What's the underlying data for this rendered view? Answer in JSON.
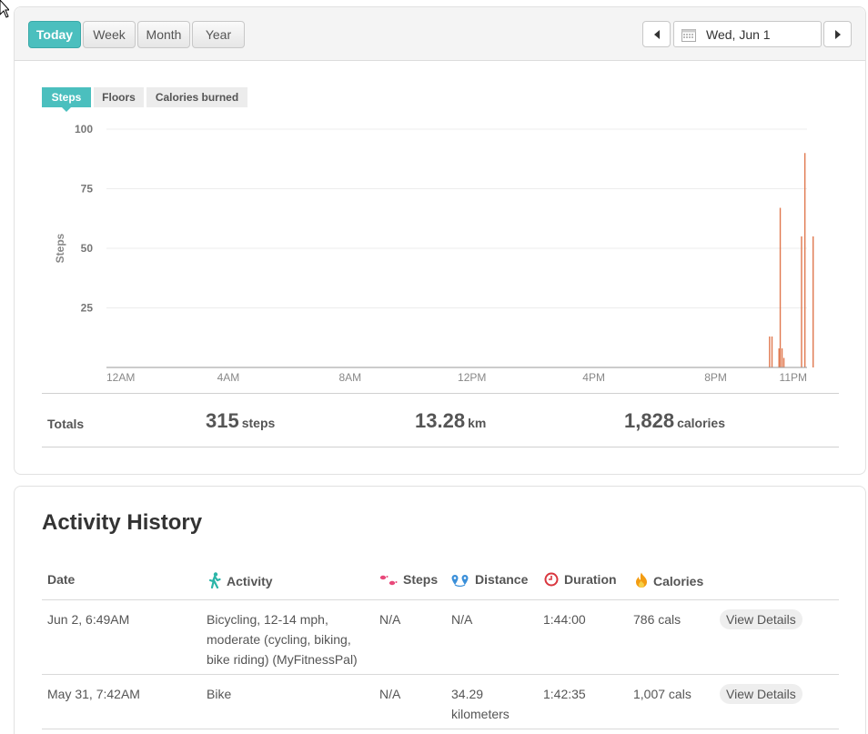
{
  "toolbar": {
    "periods": [
      "Today",
      "Week",
      "Month",
      "Year"
    ],
    "active_period": "Today",
    "date": "Wed, Jun 1"
  },
  "metric_tabs": [
    "Steps",
    "Floors",
    "Calories burned"
  ],
  "active_metric": "Steps",
  "chart_data": {
    "type": "bar",
    "ylabel": "Steps",
    "yticks": [
      100,
      75,
      50,
      25
    ],
    "ylim": [
      0,
      100
    ],
    "xticks": [
      "12AM",
      "4AM",
      "8AM",
      "12PM",
      "4PM",
      "8PM",
      "11PM"
    ],
    "x_unit": "hour of day",
    "bar_color": "#e0784e",
    "values": [
      {
        "hour": 21.77,
        "steps": 13
      },
      {
        "hour": 21.85,
        "steps": 13
      },
      {
        "hour": 22.08,
        "steps": 8
      },
      {
        "hour": 22.12,
        "steps": 67
      },
      {
        "hour": 22.18,
        "steps": 8
      },
      {
        "hour": 22.24,
        "steps": 4
      },
      {
        "hour": 22.82,
        "steps": 55
      },
      {
        "hour": 22.93,
        "steps": 90
      },
      {
        "hour": 23.2,
        "steps": 55
      }
    ]
  },
  "totals": {
    "label": "Totals",
    "steps": {
      "value": "315",
      "unit": "steps"
    },
    "distance": {
      "value": "13.28",
      "unit": "km"
    },
    "calories": {
      "value": "1,828",
      "unit": "calories"
    }
  },
  "activity_history": {
    "title": "Activity History",
    "columns": [
      {
        "label": "Date",
        "icon": ""
      },
      {
        "label": "Activity",
        "icon": "walking-person-icon"
      },
      {
        "label": "Steps",
        "icon": "footprints-icon"
      },
      {
        "label": "Distance",
        "icon": "route-pins-icon"
      },
      {
        "label": "Duration",
        "icon": "clock-icon"
      },
      {
        "label": "Calories",
        "icon": "flame-icon"
      }
    ],
    "rows": [
      {
        "date": "Jun 2, 6:49AM",
        "activity_lines": [
          "Bicycling, 12-14 mph,",
          "moderate (cycling, biking,",
          "bike riding) (MyFitnessPal)"
        ],
        "steps": "N/A",
        "distance_lines": [
          "N/A"
        ],
        "duration": "1:44:00",
        "calories": "786 cals",
        "action": "View Details"
      },
      {
        "date": "May 31, 7:42AM",
        "activity_lines": [
          "Bike"
        ],
        "steps": "N/A",
        "distance_lines": [
          "34.29",
          "kilometers"
        ],
        "duration": "1:42:35",
        "calories": "1,007 cals",
        "action": "View Details"
      }
    ]
  },
  "colors": {
    "accent": "#4bbfbe",
    "bar": "#e0784e",
    "steps_icon": "#e8487a",
    "distance_icon": "#3a8fd9",
    "clock_icon": "#d9363e",
    "flame_icon": "#f39c12",
    "walker_icon": "#2bb5a8"
  }
}
